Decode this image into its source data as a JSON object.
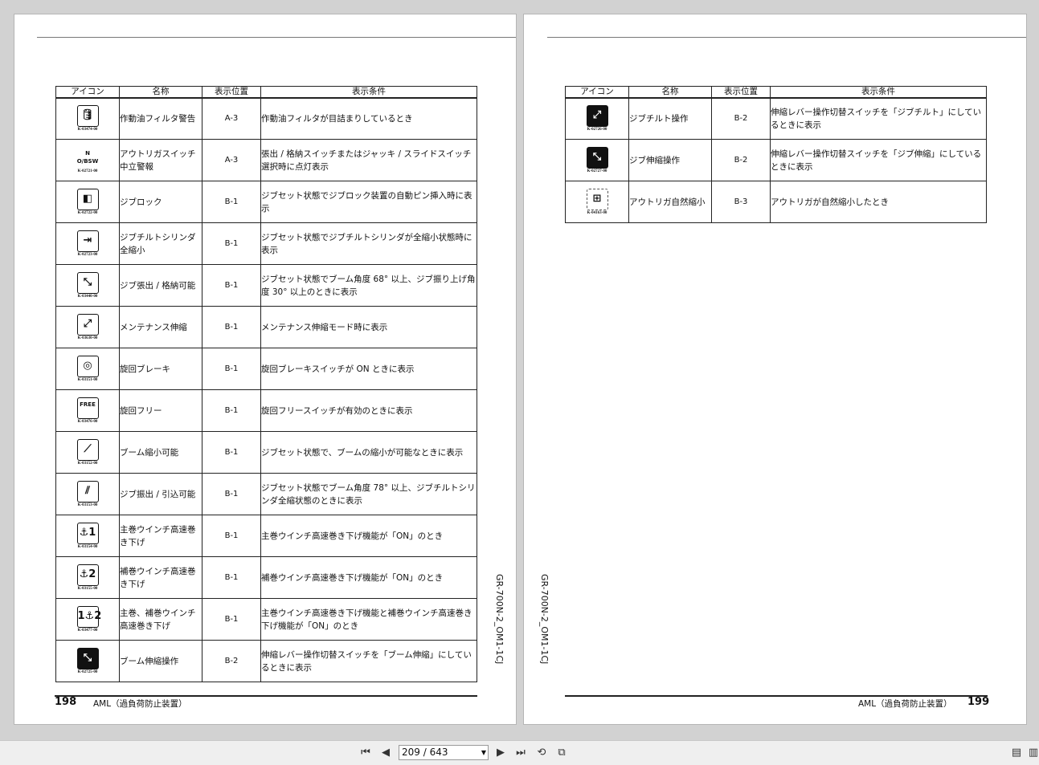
{
  "table_headers": [
    "アイコン",
    "名称",
    "表示位置",
    "表示条件"
  ],
  "left_page": {
    "rows": [
      {
        "icon": "hydraulic-filter-icon",
        "glyph": "🛢",
        "code": "K-03474-00",
        "name": "作動油フィルタ警告",
        "position": "A-3",
        "condition": "作動油フィルタが目詰まりしているとき"
      },
      {
        "icon": "n-obsw-icon",
        "glyph": "N O/BSW",
        "code": "K-02721-00",
        "name": "アウトリガスイッチ中立警報",
        "position": "A-3",
        "condition": "張出 / 格納スイッチまたはジャッキ / スライドスイッチ選択時に点灯表示"
      },
      {
        "icon": "jib-lock-icon",
        "glyph": "◧",
        "code": "K-02722-00",
        "name": "ジブロック",
        "position": "B-1",
        "condition": "ジブセット状態でジブロック装置の自動ピン挿入時に表示"
      },
      {
        "icon": "jib-tilt-cylinder-icon",
        "glyph": "⇥",
        "code": "K-02723-00",
        "name": "ジブチルトシリンダ全縮小",
        "position": "B-1",
        "condition": "ジブセット状態でジブチルトシリンダが全縮小状態時に表示"
      },
      {
        "icon": "jib-extend-stow-icon",
        "glyph": "⤡",
        "code": "K-03440-00",
        "name": "ジブ張出 / 格納可能",
        "position": "B-1",
        "condition": "ジブセット状態でブーム角度 68° 以上、ジブ振り上げ角度 30° 以上のときに表示"
      },
      {
        "icon": "maintenance-telescope-icon",
        "glyph": "⤢",
        "code": "K-03630-00",
        "name": "メンテナンス伸縮",
        "position": "B-1",
        "condition": "メンテナンス伸縮モード時に表示"
      },
      {
        "icon": "swing-brake-icon",
        "glyph": "◎",
        "code": "K-03151-00",
        "name": "旋回ブレーキ",
        "position": "B-1",
        "condition": "旋回ブレーキスイッチが ON ときに表示"
      },
      {
        "icon": "swing-free-icon",
        "glyph": "FREE",
        "code": "K-03476-00",
        "name": "旋回フリー",
        "position": "B-1",
        "condition": "旋回フリースイッチが有効のときに表示"
      },
      {
        "icon": "boom-retract-icon",
        "glyph": "⟋",
        "code": "K-03152-00",
        "name": "ブーム縮小可能",
        "position": "B-1",
        "condition": "ジブセット状態で、ブームの縮小が可能なときに表示"
      },
      {
        "icon": "jib-swing-icon",
        "glyph": "⫽",
        "code": "K-03153-00",
        "name": "ジブ振出 / 引込可能",
        "position": "B-1",
        "condition": "ジブセット状態でブーム角度 78° 以上、ジブチルトシリンダ全縮状態のときに表示"
      },
      {
        "icon": "main-winch-fast-lower-icon",
        "glyph": "⚓1",
        "code": "K-03154-00",
        "name": "主巻ウインチ高速巻き下げ",
        "position": "B-1",
        "condition": "主巻ウインチ高速巻き下げ機能が「ON」のとき"
      },
      {
        "icon": "aux-winch-fast-lower-icon",
        "glyph": "⚓2",
        "code": "K-03155-00",
        "name": "補巻ウインチ高速巻き下げ",
        "position": "B-1",
        "condition": "補巻ウインチ高速巻き下げ機能が「ON」のとき"
      },
      {
        "icon": "main-aux-winch-fast-lower-icon",
        "glyph": "1⚓2",
        "code": "K-03477-00",
        "name": "主巻、補巻ウインチ高速巻き下げ",
        "position": "B-1",
        "condition": "主巻ウインチ高速巻き下げ機能と補巻ウインチ高速巻き下げ機能が「ON」のとき"
      },
      {
        "icon": "boom-telescope-operation-icon",
        "glyph": "⤡",
        "code": "K-02725-00",
        "name": "ブーム伸縮操作",
        "position": "B-2",
        "condition": "伸縮レバー操作切替スイッチを「ブーム伸縮」にしているときに表示"
      }
    ],
    "page_number": "198",
    "section": "AML（過負荷防止装置）",
    "doc_id": "GR-700N-2_OM1-1CJ"
  },
  "right_page": {
    "rows": [
      {
        "icon": "jib-tilt-operation-icon",
        "glyph": "⤢",
        "code": "K-02726-00",
        "name": "ジブチルト操作",
        "position": "B-2",
        "condition": "伸縮レバー操作切替スイッチを「ジブチルト」にしているときに表示"
      },
      {
        "icon": "jib-telescope-operation-icon",
        "glyph": "⤡",
        "code": "K-02727-00",
        "name": "ジブ伸縮操作",
        "position": "B-2",
        "condition": "伸縮レバー操作切替スイッチを「ジブ伸縮」にしているときに表示"
      },
      {
        "icon": "outrigger-retract-icon",
        "glyph": "⊞",
        "code": "K-04163-00",
        "name": "アウトリガ自然縮小",
        "position": "B-3",
        "condition": "アウトリガが自然縮小したとき"
      }
    ],
    "page_number": "199",
    "section": "AML（過負荷防止装置）",
    "doc_id": "GR-700N-2_OM1-1CJ"
  },
  "toolbar": {
    "page_indicator": "209 / 643"
  }
}
